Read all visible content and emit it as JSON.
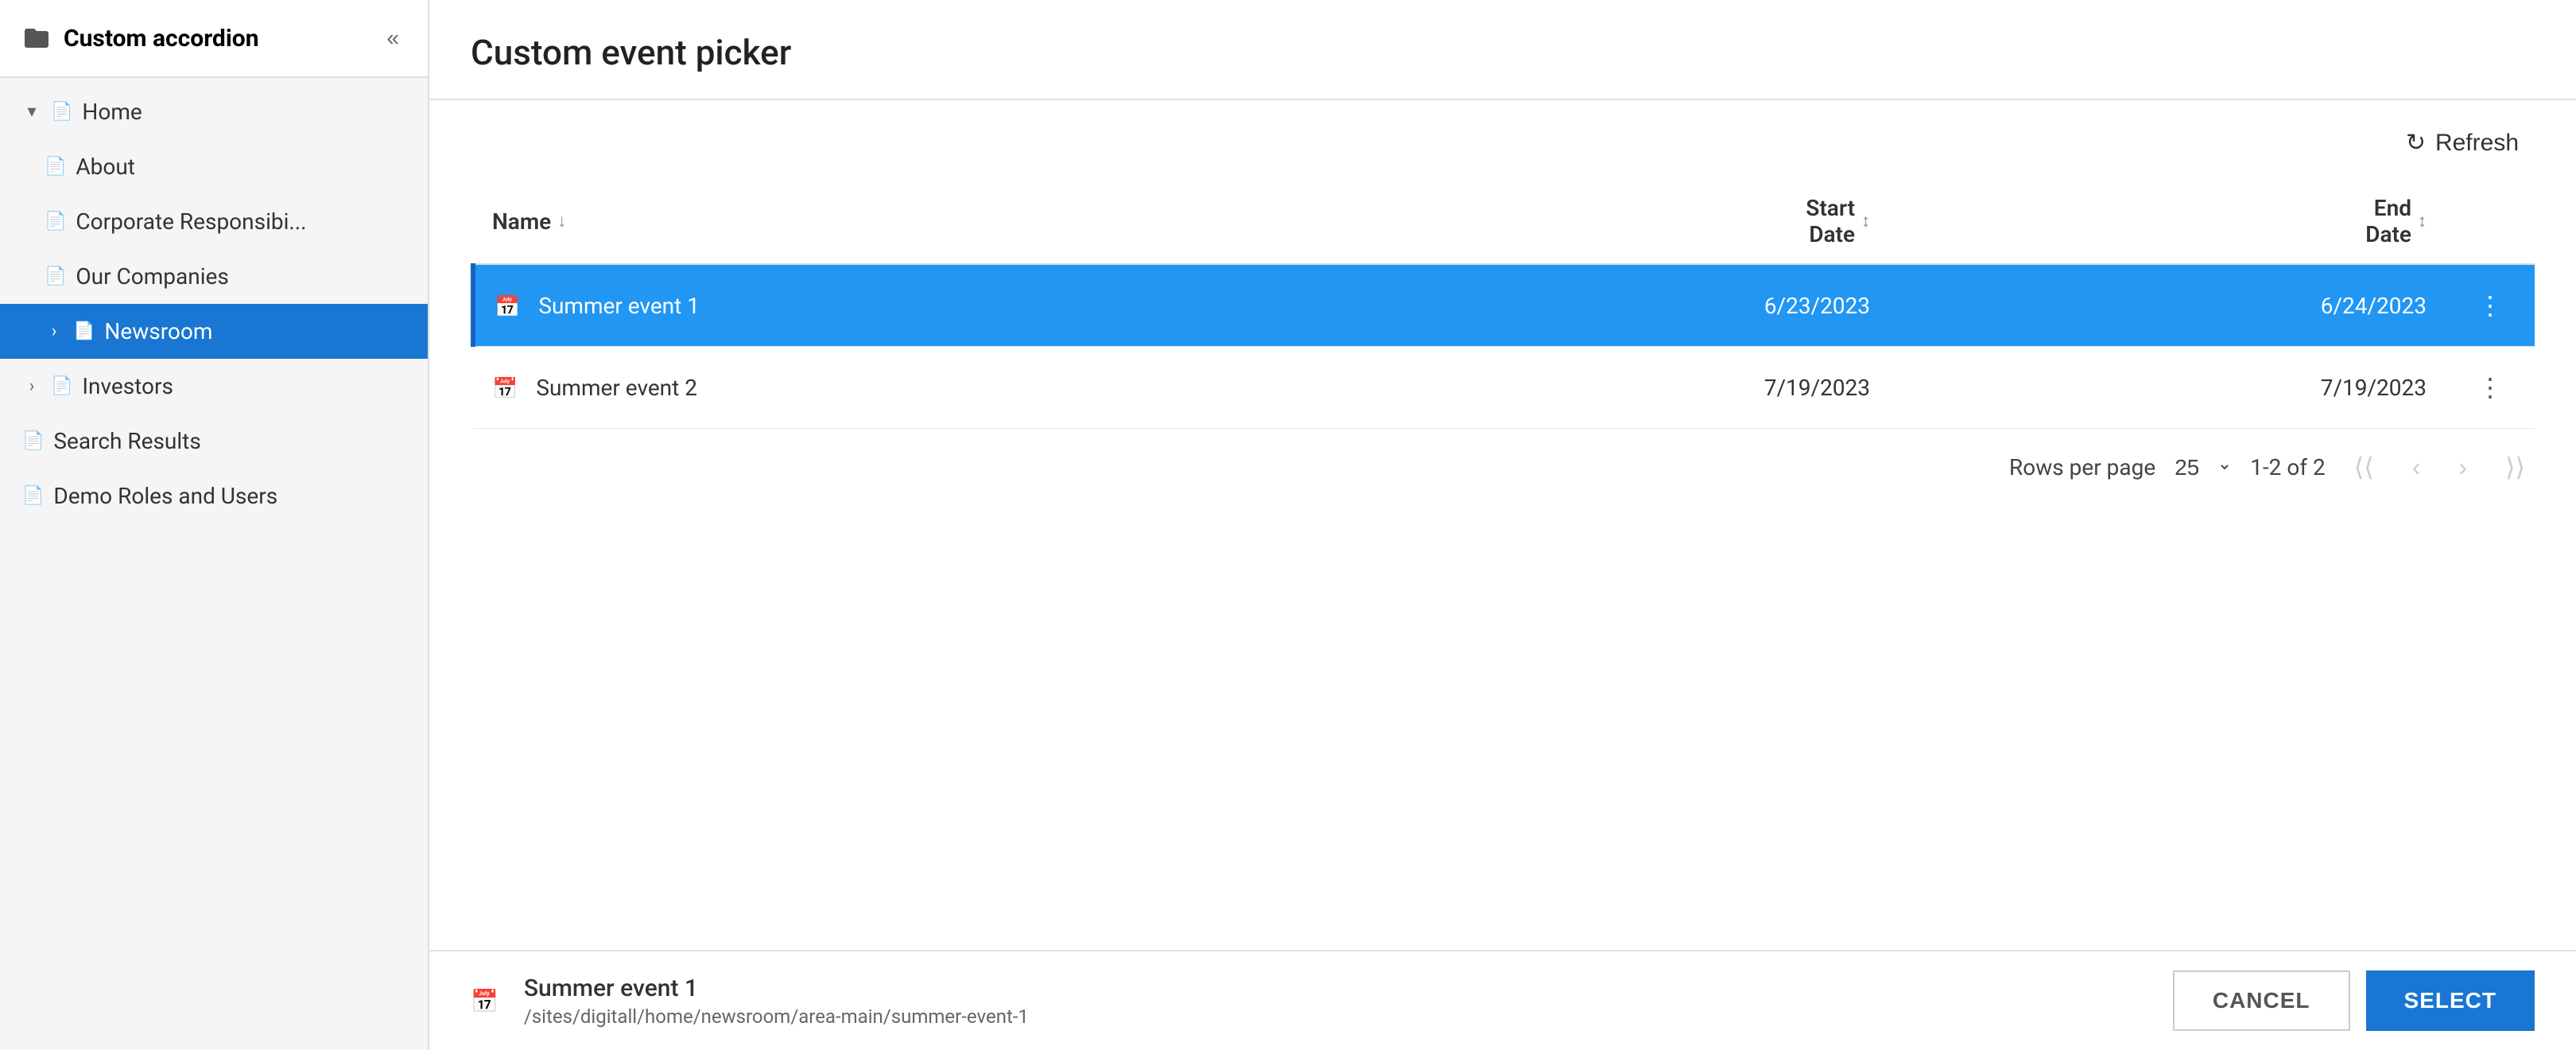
{
  "sidebar": {
    "header": "Custom accordion",
    "collapse_label": "«",
    "items": [
      {
        "id": "home",
        "label": "Home",
        "indent": 0,
        "chevron": "▾",
        "hasPage": true,
        "expanded": true
      },
      {
        "id": "about",
        "label": "About",
        "indent": 1,
        "hasPage": true
      },
      {
        "id": "corporate",
        "label": "Corporate Responsibi...",
        "indent": 1,
        "hasPage": true
      },
      {
        "id": "our-companies",
        "label": "Our Companies",
        "indent": 1,
        "hasPage": true
      },
      {
        "id": "newsroom",
        "label": "Newsroom",
        "indent": 1,
        "chevron": "›",
        "hasPage": true,
        "active": true
      },
      {
        "id": "investors",
        "label": "Investors",
        "indent": 0,
        "chevron": "›",
        "hasPage": true
      },
      {
        "id": "search-results",
        "label": "Search Results",
        "indent": 0,
        "hasPage": true
      },
      {
        "id": "demo-roles",
        "label": "Demo Roles and Users",
        "indent": 0,
        "hasPage": true
      }
    ]
  },
  "dialog": {
    "title": "Custom event picker",
    "refresh_label": "Refresh",
    "table": {
      "columns": [
        {
          "id": "name",
          "label": "Name",
          "sortable": true
        },
        {
          "id": "start_date",
          "label": "Start\nDate",
          "sortable": true
        },
        {
          "id": "end_date",
          "label": "End\nDate",
          "sortable": true
        }
      ],
      "rows": [
        {
          "id": 1,
          "name": "Summer event 1",
          "start_date": "6/23/2023",
          "end_date": "6/24/2023",
          "selected": true
        },
        {
          "id": 2,
          "name": "Summer event 2",
          "start_date": "7/19/2023",
          "end_date": "7/19/2023",
          "selected": false
        }
      ]
    },
    "pagination": {
      "rows_per_page_label": "Rows per page",
      "rows_per_page_value": "25",
      "page_info": "1-2 of 2"
    },
    "footer": {
      "selected_name": "Summer event 1",
      "selected_path": "/sites/digitall/home/newsroom/area-main/summer-event-1",
      "cancel_label": "CANCEL",
      "select_label": "SELECT"
    }
  }
}
